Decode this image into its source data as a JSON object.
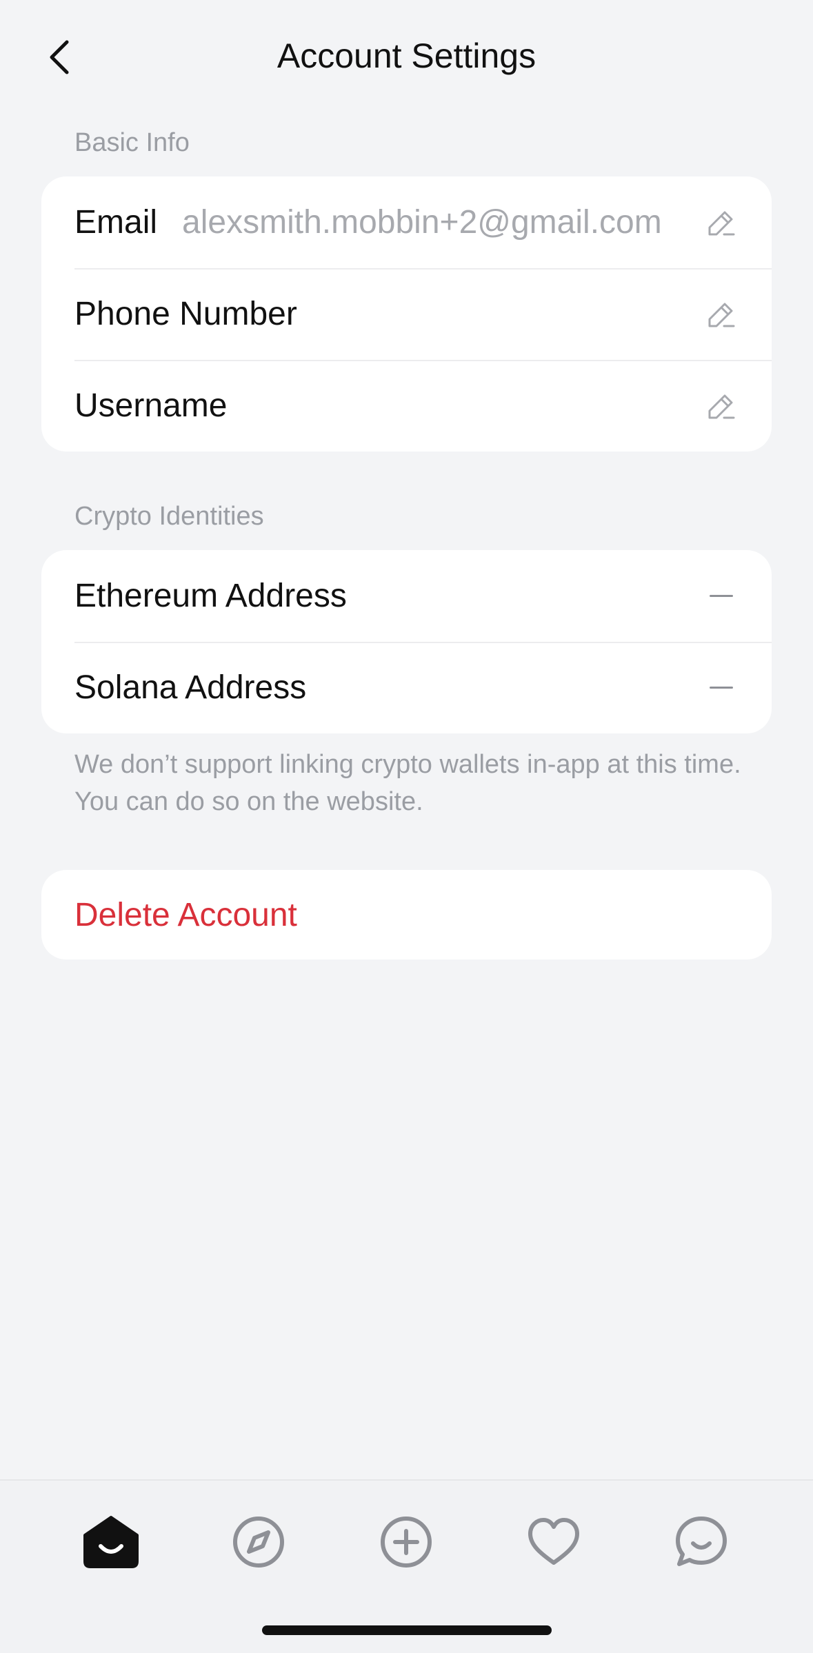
{
  "header": {
    "title": "Account Settings",
    "back_icon": "chevron-left-icon"
  },
  "basic_info": {
    "section_label": "Basic Info",
    "rows": [
      {
        "label": "Email",
        "value": "alexsmith.mobbin+2@gmail.com",
        "icon": "pencil-icon"
      },
      {
        "label": "Phone Number",
        "value": "",
        "icon": "pencil-icon"
      },
      {
        "label": "Username",
        "value": "",
        "icon": "pencil-icon"
      }
    ]
  },
  "crypto": {
    "section_label": "Crypto Identities",
    "rows": [
      {
        "label": "Ethereum Address",
        "icon": "dash-icon"
      },
      {
        "label": "Solana Address",
        "icon": "dash-icon"
      }
    ],
    "note": "We don’t support linking crypto wallets in-app at this time. You can do so on the website."
  },
  "danger": {
    "delete_label": "Delete Account",
    "color": "#d9303a"
  },
  "bottom_nav": {
    "items": [
      {
        "icon": "home-icon",
        "active": true
      },
      {
        "icon": "compass-icon",
        "active": false
      },
      {
        "icon": "plus-circle-icon",
        "active": false
      },
      {
        "icon": "heart-icon",
        "active": false
      },
      {
        "icon": "chat-bubble-icon",
        "active": false
      }
    ]
  },
  "colors": {
    "background": "#f3f4f6",
    "card": "#ffffff",
    "muted_text": "#9a9da3",
    "danger": "#d9303a",
    "icon_gray": "#8e9096"
  }
}
